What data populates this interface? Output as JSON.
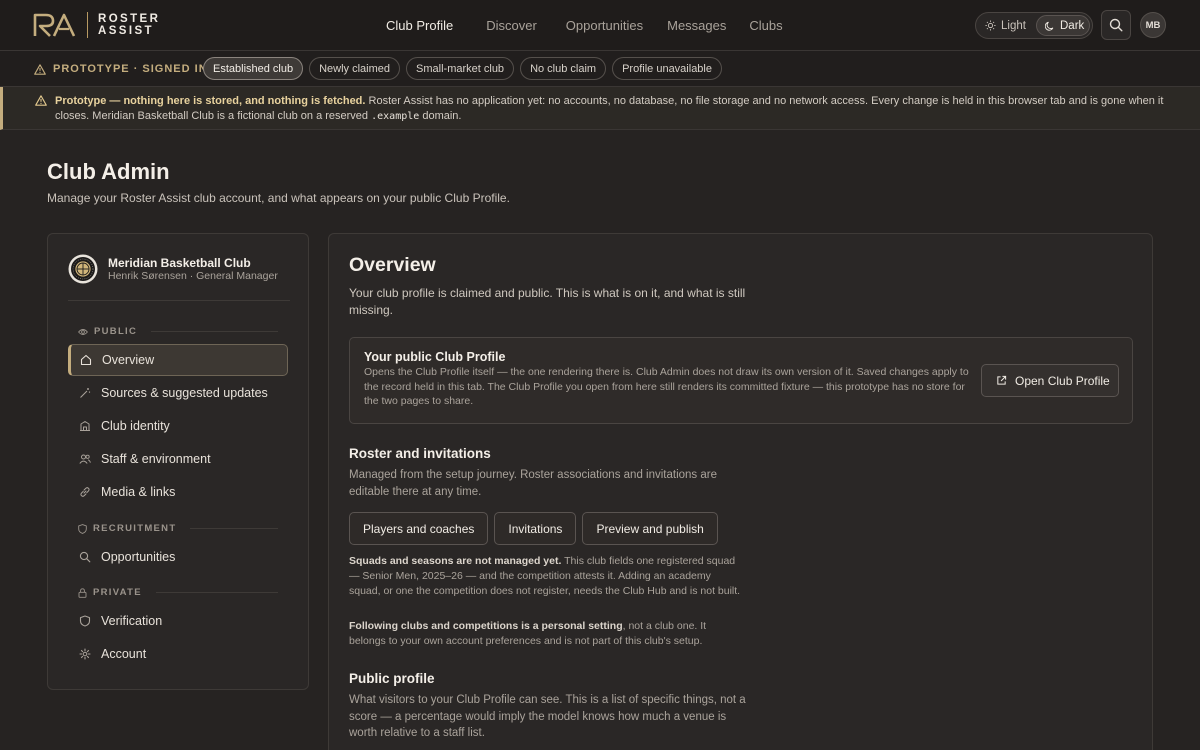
{
  "brand": {
    "line1": "ROSTER",
    "line2": "ASSIST",
    "logo_icon": "ra-monogram-icon",
    "accent": "#c4ad7e"
  },
  "nav": {
    "links": [
      "Club Profile",
      "Discover",
      "Opportunities",
      "Messages",
      "Clubs"
    ],
    "active": "Club Profile",
    "theme": {
      "light_label": "Light",
      "dark_label": "Dark",
      "selected": "Dark"
    },
    "avatar": "MB"
  },
  "protobar": {
    "label": "PROTOTYPE · SIGNED IN AS",
    "chips": [
      "Established club",
      "Newly claimed",
      "Small-market club",
      "No club claim",
      "Profile unavailable"
    ],
    "active_chip": "Established club"
  },
  "notice": {
    "bold": "Prototype — nothing here is stored, and nothing is fetched.",
    "text": " Roster Assist has no application yet: no accounts, no database, no file storage and no network access. Every change is held in this browser tab and is gone when it closes. Meridian Basketball Club is a fictional club on a reserved ",
    "code": ".example",
    "tail": " domain."
  },
  "header": {
    "title": "Club Admin",
    "subtitle": "Manage your Roster Assist club account, and what appears on your public Club Profile."
  },
  "sidebar": {
    "club_name": "Meridian Basketball Club",
    "person": "Henrik Sørensen · General Manager",
    "sections": {
      "public": "PUBLIC",
      "recruitment": "RECRUITMENT",
      "private": "PRIVATE"
    },
    "items": [
      {
        "label": "Overview",
        "icon": "home-icon"
      },
      {
        "label": "Sources & suggested updates",
        "icon": "wand-icon"
      },
      {
        "label": "Club identity",
        "icon": "building-icon"
      },
      {
        "label": "Staff & environment",
        "icon": "users-icon"
      },
      {
        "label": "Media & links",
        "icon": "link-icon"
      },
      {
        "label": "Opportunities",
        "icon": "search-icon"
      },
      {
        "label": "Verification",
        "icon": "shield-icon"
      },
      {
        "label": "Account",
        "icon": "gear-icon"
      }
    ],
    "active": "Overview"
  },
  "main": {
    "title": "Overview",
    "subtitle": "Your club profile is claimed and public. This is what is on it, and what is still missing.",
    "public_box": {
      "title": "Your public Club Profile",
      "text": "Opens the Club Profile itself — the one rendering there is. Club Admin does not draw its own version of it. Saved changes apply to the record held in this tab. The Club Profile you open from here still renders its committed fixture — this prototype has no store for the two pages to share.",
      "button": "Open Club Profile"
    },
    "roster": {
      "title": "Roster and invitations",
      "text": "Managed from the setup journey. Roster associations and invitations are editable there at any time.",
      "buttons": [
        "Players and coaches",
        "Invitations",
        "Preview and publish"
      ],
      "note1_bold": "Squads and seasons are not managed yet.",
      "note1": " This club fields one registered squad — Senior Men, 2025–26 — and the competition attests it. Adding an academy squad, or one the competition does not register, needs the Club Hub and is not built.",
      "note2_bold": "Following clubs and competitions is a personal setting",
      "note2": ", not a club one. It belongs to your own account preferences and is not part of this club's setup."
    },
    "public_profile": {
      "title": "Public profile",
      "text": "What visitors to your Club Profile can see. This is a list of specific things, not a score — a percentage would imply the model knows how much a venue is worth relative to a staff list."
    }
  }
}
